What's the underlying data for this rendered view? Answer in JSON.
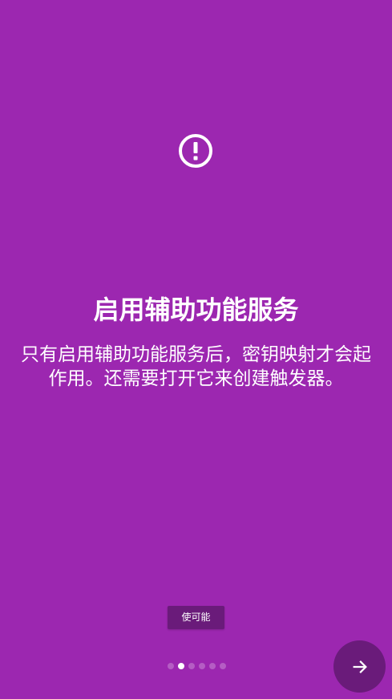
{
  "onboarding": {
    "icon": "alert-circle-icon",
    "title": "启用辅助功能服务",
    "description": "只有启用辅助功能服务后，密钥映射才会起作用。还需要打开它来创建触发器。",
    "enable_button_label": "使可能",
    "page_count": 6,
    "current_page": 2,
    "next_icon": "arrow-right-icon"
  },
  "colors": {
    "background": "#9c27b0",
    "button": "#6a1b7a",
    "text": "#ffffff"
  }
}
